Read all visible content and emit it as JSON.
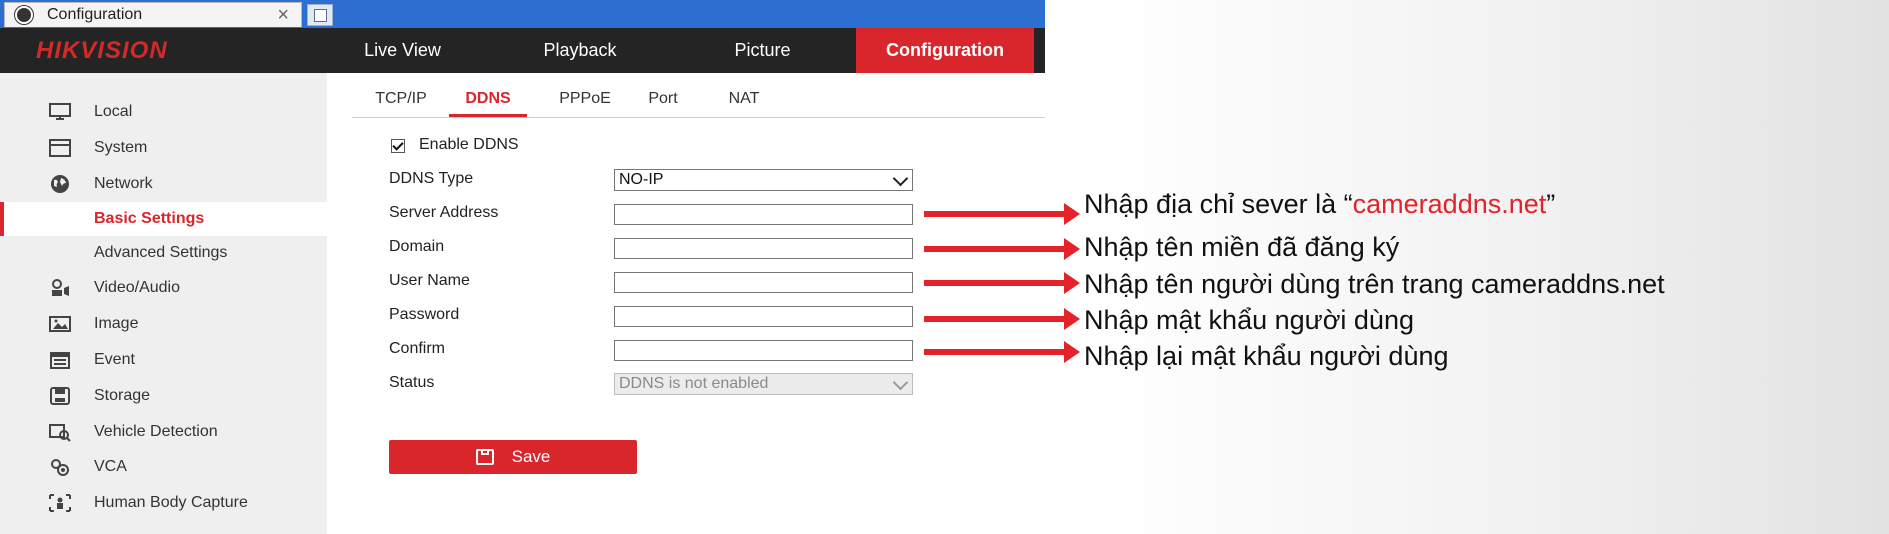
{
  "browser": {
    "tab_title": "Configuration",
    "tab_close": "×"
  },
  "header": {
    "logo": "HIKVISION",
    "nav": [
      "Live View",
      "Playback",
      "Picture",
      "Configuration"
    ],
    "active_nav": "Configuration",
    "accent_color": "#d8262c"
  },
  "sidebar": {
    "items": [
      {
        "label": "Local",
        "icon": "monitor-icon"
      },
      {
        "label": "System",
        "icon": "system-window-icon"
      },
      {
        "label": "Network",
        "icon": "globe-icon"
      },
      {
        "label": "Basic Settings",
        "selected": true
      },
      {
        "label": "Advanced Settings"
      },
      {
        "label": "Video/Audio",
        "icon": "video-audio-icon"
      },
      {
        "label": "Image",
        "icon": "image-icon"
      },
      {
        "label": "Event",
        "icon": "calendar-event-icon"
      },
      {
        "label": "Storage",
        "icon": "storage-disk-icon"
      },
      {
        "label": "Vehicle Detection",
        "icon": "vehicle-detection-icon"
      },
      {
        "label": "VCA",
        "icon": "vca-icon"
      },
      {
        "label": "Human Body Capture",
        "icon": "human-body-icon"
      }
    ]
  },
  "subtabs": [
    "TCP/IP",
    "DDNS",
    "PPPoE",
    "Port",
    "NAT"
  ],
  "active_subtab": "DDNS",
  "form": {
    "enable_label": "Enable DDNS",
    "enable_checked": true,
    "ddns_type_label": "DDNS Type",
    "ddns_type_value": "NO-IP",
    "server_address_label": "Server Address",
    "domain_label": "Domain",
    "username_label": "User Name",
    "password_label": "Password",
    "confirm_label": "Confirm",
    "status_label": "Status",
    "status_value": "DDNS is not enabled",
    "save_label": "Save"
  },
  "annotations": {
    "server_prefix": "Nhập địa chỉ sever là “",
    "server_highlight": "cameraddns.net",
    "server_suffix": "”",
    "domain": "Nhập tên miền đã đăng ký",
    "username": "Nhập tên người dùng trên trang cameraddns.net",
    "password": "Nhập mật khẩu người dùng",
    "confirm": "Nhập lại mật khẩu người dùng",
    "arrow_color": "#e3222a"
  }
}
